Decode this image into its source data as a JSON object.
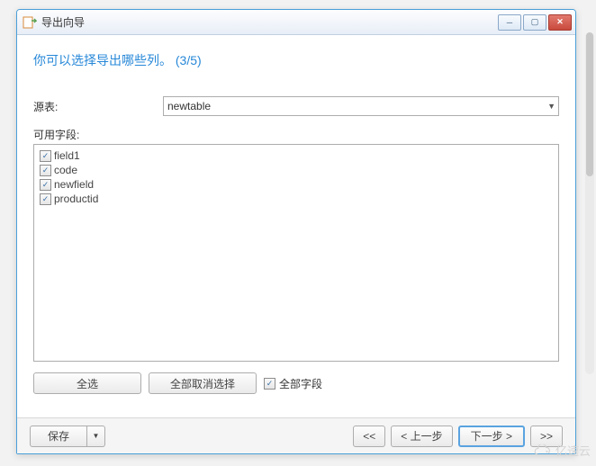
{
  "window": {
    "title": "导出向导"
  },
  "heading": {
    "text": "你可以选择导出哪些列。",
    "step": "(3/5)"
  },
  "source": {
    "label": "源表:",
    "value": "newtable"
  },
  "fields": {
    "label": "可用字段:",
    "items": [
      {
        "name": "field1",
        "checked": true
      },
      {
        "name": "code",
        "checked": true
      },
      {
        "name": "newfield",
        "checked": true
      },
      {
        "name": "productid",
        "checked": true
      }
    ]
  },
  "buttons": {
    "select_all": "全选",
    "deselect_all": "全部取消选择",
    "all_fields": "全部字段",
    "save": "保存",
    "first": "<<",
    "prev": "< 上一步",
    "next": "下一步 >",
    "last": ">>"
  },
  "watermark": "亿速云"
}
